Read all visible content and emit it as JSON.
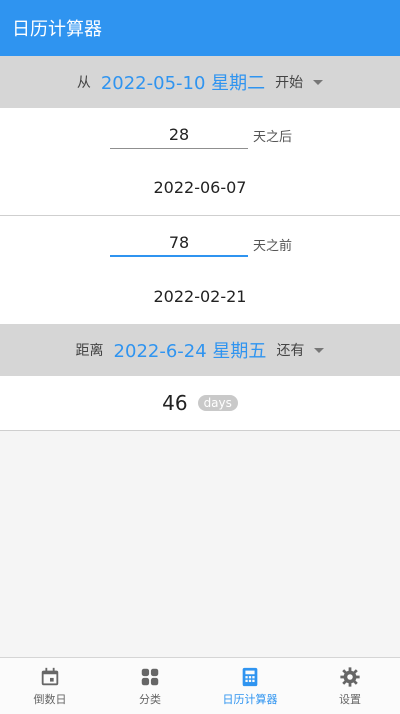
{
  "app": {
    "title": "日历计算器"
  },
  "from_bar": {
    "prefix": "从",
    "date": "2022-05-10 星期二",
    "mode": "开始"
  },
  "after_calc": {
    "value": "28",
    "suffix": "天之后",
    "result": "2022-06-07"
  },
  "before_calc": {
    "value": "78",
    "suffix": "天之前",
    "result": "2022-02-21"
  },
  "distance_bar": {
    "prefix": "距离",
    "date": "2022-6-24 星期五",
    "mode": "还有"
  },
  "distance_result": {
    "count": "46",
    "unit": "days"
  },
  "bottom_nav": {
    "items": [
      {
        "label": "倒数日",
        "icon": "calendar-icon"
      },
      {
        "label": "分类",
        "icon": "grid-icon"
      },
      {
        "label": "日历计算器",
        "icon": "calculator-icon"
      },
      {
        "label": "设置",
        "icon": "gear-icon"
      }
    ],
    "active_index": 2
  },
  "colors": {
    "accent": "#2f94f0",
    "band": "#d6d6d6",
    "pill": "#c9c9c9"
  }
}
